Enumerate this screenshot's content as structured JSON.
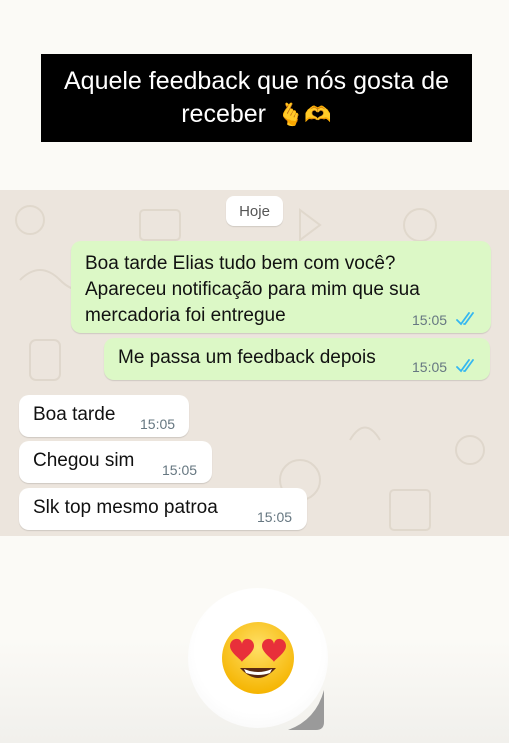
{
  "caption": {
    "text": "Aquele feedback que nós gosta de receber",
    "emojis": "🫰🫶"
  },
  "chat": {
    "date_chip": "Hoje",
    "messages": [
      {
        "direction": "outgoing",
        "text": "Boa tarde Elias tudo bem com você?\nApareceu notificação para mim que sua\nmercadoria foi entregue",
        "time": "15:05",
        "status": "read"
      },
      {
        "direction": "outgoing",
        "text": "Me passa um feedback depois",
        "time": "15:05",
        "status": "read"
      },
      {
        "direction": "incoming",
        "text": "Boa tarde",
        "time": "15:05"
      },
      {
        "direction": "incoming",
        "text": "Chegou sim",
        "time": "15:05"
      },
      {
        "direction": "incoming",
        "text": "Slk top mesmo patroa",
        "time": "15:05"
      }
    ]
  },
  "sticker": {
    "emoji": "😍",
    "icon": "heart-eyes-emoji"
  },
  "colors": {
    "outgoing_bubble": "#dcf8c6",
    "incoming_bubble": "#ffffff",
    "chat_background": "#ece5dd",
    "read_ticks": "#34b7f1"
  }
}
